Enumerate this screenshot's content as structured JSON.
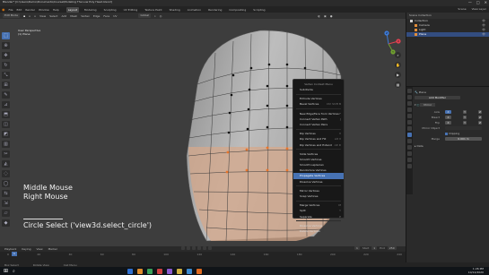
{
  "window": {
    "title": "Blender* [C:\\Users\\Demo\\Documents\\Course\\Modeling The Low Poly Head.blend]",
    "controls": [
      "—",
      "□",
      "✕"
    ]
  },
  "menubar": {
    "items": [
      "File",
      "Edit",
      "Render",
      "Window",
      "Help"
    ],
    "workspaces": [
      "Layout",
      "Modeling",
      "Sculpting",
      "UV Editing",
      "Texture Paint",
      "Shading",
      "Animation",
      "Rendering",
      "Compositing",
      "Scripting"
    ],
    "active_workspace": "Layout",
    "scene": "Scene",
    "view_layer": "View Layer"
  },
  "viewport": {
    "mode": "Edit Mode",
    "header_items": [
      "View",
      "Select",
      "Add",
      "Mesh",
      "Vertex",
      "Edge",
      "Face",
      "UV"
    ],
    "transform": "Global",
    "view_name": "User Perspective",
    "object_name": "(1) Plane",
    "gizmo_axes": [
      "X",
      "Y",
      "Z"
    ]
  },
  "context_menu": {
    "title": "Vertex Context Menu",
    "items": [
      {
        "label": "Subdivide",
        "shortcut": ""
      },
      {
        "sep": true
      },
      {
        "label": "Extrude Vertices",
        "shortcut": ""
      },
      {
        "label": "Bevel Vertices",
        "shortcut": "Ctrl Shift B"
      },
      {
        "sep": true
      },
      {
        "label": "New Edge/Face from Vertices",
        "shortcut": "F"
      },
      {
        "label": "Connect Vertex Path",
        "shortcut": "J"
      },
      {
        "label": "Connect Vertex Pairs",
        "shortcut": ""
      },
      {
        "sep": true
      },
      {
        "label": "Rip Vertices",
        "shortcut": "V"
      },
      {
        "label": "Rip Vertices and Fill",
        "shortcut": "Alt V"
      },
      {
        "label": "Rip Vertices and Extend",
        "shortcut": "Alt D"
      },
      {
        "sep": true
      },
      {
        "label": "Slide Vertices",
        "shortcut": ""
      },
      {
        "label": "Smooth Vertices",
        "shortcut": ""
      },
      {
        "label": "Smooth Laplacian",
        "shortcut": ""
      },
      {
        "label": "Randomize Vertices",
        "shortcut": ""
      },
      {
        "label": "Propagate Vertices",
        "shortcut": "",
        "highlighted": true
      },
      {
        "label": "Dissolve Vertices",
        "shortcut": ""
      },
      {
        "sep": true
      },
      {
        "label": "Mirror Vertices",
        "shortcut": ""
      },
      {
        "label": "Snap Vertices",
        "shortcut": ""
      },
      {
        "sep": true
      },
      {
        "label": "Merge Vertices",
        "shortcut": "M"
      },
      {
        "label": "Split",
        "shortcut": "Y"
      },
      {
        "label": "Separate",
        "shortcut": "P"
      },
      {
        "sep": true
      },
      {
        "label": "Dissolve Vertices",
        "shortcut": ""
      },
      {
        "label": "Delete Vertices",
        "shortcut": ""
      }
    ]
  },
  "keys_overlay": {
    "key1": "Middle Mouse",
    "key2": "Right Mouse",
    "operator": "Circle Select ('view3d.select_circle')"
  },
  "timeline": {
    "menus": [
      "Playback",
      "Keying",
      "View",
      "Marker"
    ],
    "ticks": [
      "0",
      "20",
      "40",
      "60",
      "80",
      "100",
      "120",
      "140",
      "160",
      "180",
      "200",
      "220",
      "240"
    ],
    "current_frame": "1",
    "start_label": "Start",
    "start": "1",
    "end_label": "End",
    "end": "250"
  },
  "statusbar": {
    "items": [
      "Box Select",
      "Rotate View",
      "Call Menu"
    ]
  },
  "outliner": {
    "title": "Scene Collection",
    "items": [
      {
        "label": "Collection",
        "selected": false
      },
      {
        "label": "Camera",
        "selected": false
      },
      {
        "label": "Light",
        "selected": false
      },
      {
        "label": "Plane",
        "selected": true
      }
    ]
  },
  "properties": {
    "object": "Plane",
    "panel": "Add Modifier",
    "modifier": "Mirror",
    "axis_label": "Axis",
    "axis": [
      "X",
      "Y",
      "Z"
    ],
    "bisect_label": "Bisect",
    "flip_label": "Flip",
    "mirror_object_label": "Mirror Object",
    "clipping_label": "Clipping",
    "merge_label": "Merge",
    "merge_value": "0.001 m",
    "data_label": "Data"
  },
  "taskbar": {
    "time": "1:26 PM",
    "date": "10/12/2020",
    "app_colors": [
      "#2f6fd0",
      "#e08c2c",
      "#3aa15a",
      "#d04040",
      "#8a5ad0",
      "#d0b040",
      "#3a8ad0",
      "#e06a20"
    ]
  }
}
